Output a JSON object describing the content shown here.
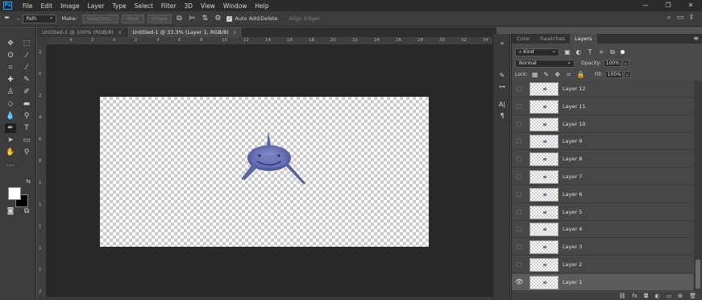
{
  "app": {
    "logo": "Ps"
  },
  "menu": [
    "File",
    "Edit",
    "Image",
    "Layer",
    "Type",
    "Select",
    "Filter",
    "3D",
    "View",
    "Window",
    "Help"
  ],
  "window_controls": {
    "minimize": "—",
    "restore": "❐",
    "close": "✕"
  },
  "options": {
    "mode": "Path",
    "make_label": "Make:",
    "selection_btn": "Selection...",
    "mask_btn": "Mask",
    "shape_btn": "Shape",
    "auto_add_delete": "Auto Add/Delete",
    "align_edges": "Align Edges"
  },
  "tabs": [
    {
      "label": "Untitled-1 @ 100% (RGB/8)",
      "close": "×"
    },
    {
      "label": "Untitled-1 @ 33.3% (Layer 1, RGB/8)",
      "close": "×"
    }
  ],
  "ruler_h": [
    "4",
    "2",
    "0",
    "2",
    "4",
    "6",
    "8",
    "10",
    "12",
    "14",
    "16",
    "18",
    "20",
    "22",
    "24",
    "26",
    "28",
    "30",
    "32",
    "34"
  ],
  "ruler_v": [
    "2",
    "0",
    "2",
    "4",
    "6",
    "8",
    "1",
    "1",
    "1",
    "1",
    "1",
    "2"
  ],
  "colors": {
    "foreground": "#ffffff",
    "background": "#000000",
    "shark": "#5d68ac"
  },
  "panel": {
    "tabs": [
      "Color",
      "Swatches",
      "Layers"
    ],
    "active_tab": "Layers",
    "kind_label": "Kind",
    "blend_mode": "Normal",
    "opacity_label": "Opacity:",
    "opacity_value": "100%",
    "lock_label": "Lock:",
    "fill_label": "Fill:",
    "fill_value": "100%"
  },
  "layers": [
    {
      "name": "Layer 12",
      "visible": false
    },
    {
      "name": "Layer 11",
      "visible": false
    },
    {
      "name": "Layer 10",
      "visible": false
    },
    {
      "name": "Layer 9",
      "visible": false
    },
    {
      "name": "Layer 8",
      "visible": false
    },
    {
      "name": "Layer 7",
      "visible": false
    },
    {
      "name": "Layer 6",
      "visible": false
    },
    {
      "name": "Layer 5",
      "visible": false
    },
    {
      "name": "Layer 4",
      "visible": false
    },
    {
      "name": "Layer 3",
      "visible": false
    },
    {
      "name": "Layer 2",
      "visible": false
    },
    {
      "name": "Layer 1",
      "visible": true,
      "selected": true
    }
  ],
  "icons": {
    "visible": "eye-icon",
    "link": "link-icon",
    "fx": "fx-icon",
    "mask": "mask-icon",
    "adjust": "adjustment-icon",
    "group": "folder-icon",
    "new": "new-layer-icon",
    "delete": "trash-icon"
  }
}
